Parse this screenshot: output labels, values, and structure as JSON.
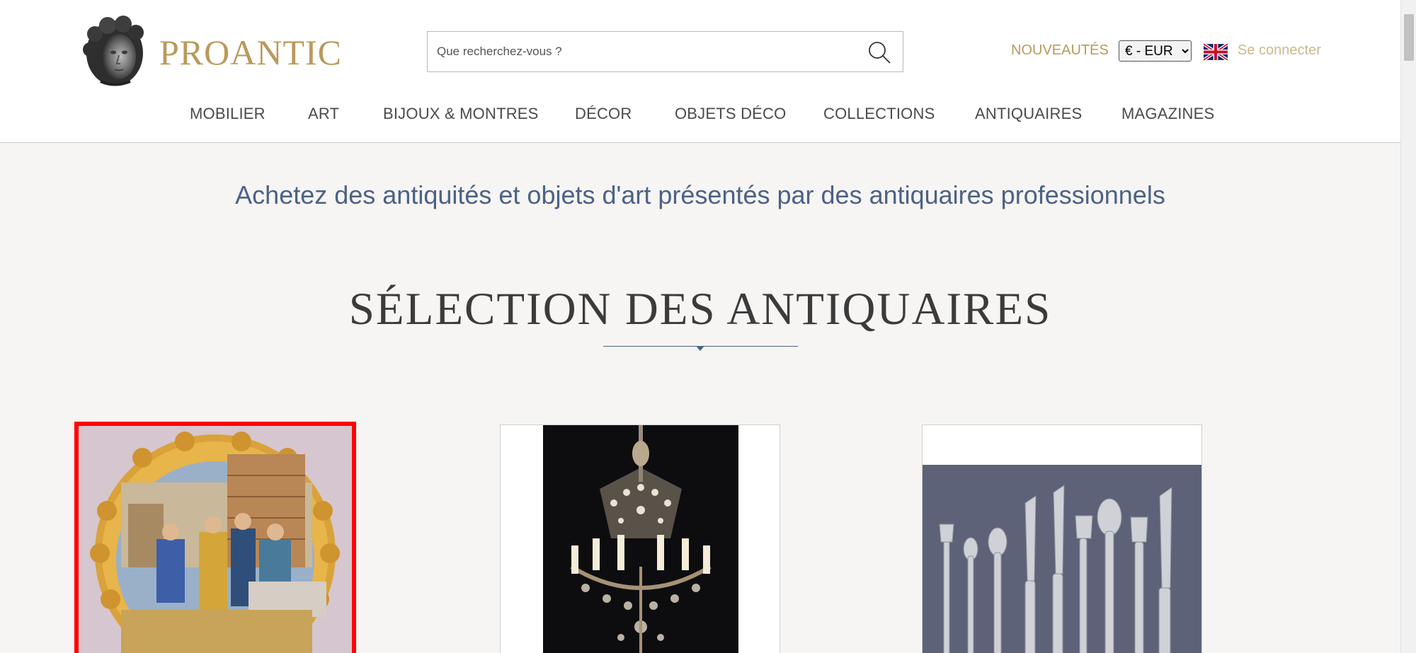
{
  "header": {
    "brand": "PROANTIC",
    "search": {
      "placeholder": "Que recherchez-vous ?"
    },
    "new_label": "NOUVEAUTÉS",
    "currency": {
      "selected": "€ - EUR"
    },
    "login_label": "Se connecter"
  },
  "nav": {
    "items": [
      "MOBILIER",
      "ART",
      "BIJOUX & MONTRES",
      "DÉCOR",
      "OBJETS DÉCO",
      "COLLECTIONS",
      "ANTIQUAIRES",
      "MAGAZINES"
    ]
  },
  "main": {
    "tagline": "Achetez des antiquités et objets d'art présentés par des antiquaires professionnels",
    "section_title": "SÉLECTION DES ANTIQUAIRES"
  },
  "products": [
    {
      "icon": "majolica-plate-image",
      "selected": true
    },
    {
      "icon": "crystal-chandelier-image",
      "selected": false
    },
    {
      "icon": "silver-cutlery-image",
      "selected": false
    }
  ],
  "colors": {
    "brand_gold": "#b99a5b",
    "tagline_blue": "#4d6185",
    "selection_red": "#ff0000",
    "background": "#f6f5f3"
  }
}
